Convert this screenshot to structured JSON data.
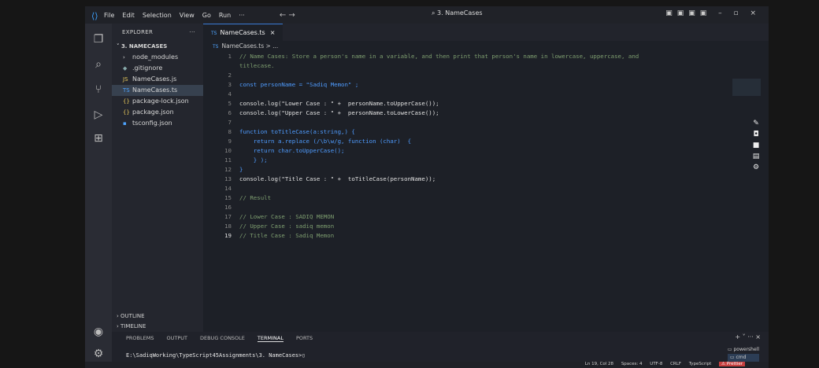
{
  "titlebar": {
    "menus": [
      "File",
      "Edit",
      "Selection",
      "View",
      "Go",
      "Run",
      "···"
    ],
    "nav": "← →",
    "search": "3. NameCases"
  },
  "sidebar": {
    "header": "EXPLORER",
    "more": "···",
    "root": "3. NAMECASES",
    "items": [
      {
        "icon": "›",
        "label": "node_modules"
      },
      {
        "icon": "◆",
        "label": ".gitignore"
      },
      {
        "icon": "JS",
        "label": "NameCases.js"
      },
      {
        "icon": "TS",
        "label": "NameCases.ts"
      },
      {
        "icon": "{}",
        "label": "package-lock.json"
      },
      {
        "icon": "{}",
        "label": "package.json"
      },
      {
        "icon": "▪",
        "label": "tsconfig.json"
      }
    ],
    "outline": "OUTLINE",
    "timeline": "TIMELINE"
  },
  "editor": {
    "tab_label": "NameCases.ts",
    "tab_ts": "TS",
    "breadcrumb": "NameCases.ts > ...",
    "lines": [
      {
        "n": "1",
        "t": "// Name Cases: Store a person's name in a variable, and then print that person's name in lowercase, uppercase, and"
      },
      {
        "n": "",
        "t": "titlecase."
      },
      {
        "n": "2",
        "t": ""
      },
      {
        "n": "3",
        "t": "const personName = \"Sadiq Memon\" ;"
      },
      {
        "n": "4",
        "t": ""
      },
      {
        "n": "5",
        "t": "console.log(\"Lower Case : \" +  personName.toUpperCase());"
      },
      {
        "n": "6",
        "t": "console.log(\"Upper Case : \" +  personName.toLowerCase());"
      },
      {
        "n": "7",
        "t": ""
      },
      {
        "n": "8",
        "t": "function toTitleCase(a:string,) {"
      },
      {
        "n": "9",
        "t": "    return a.replace (/\\b\\w/g, function (char)  {"
      },
      {
        "n": "10",
        "t": "    return char.toUpperCase();"
      },
      {
        "n": "11",
        "t": "    } );"
      },
      {
        "n": "12",
        "t": "}"
      },
      {
        "n": "13",
        "t": "console.log(\"Title Case : \" +  toTitleCase(personName));"
      },
      {
        "n": "14",
        "t": ""
      },
      {
        "n": "15",
        "t": "// Result"
      },
      {
        "n": "16",
        "t": ""
      },
      {
        "n": "17",
        "t": "// Lower Case : SADIQ MEMON"
      },
      {
        "n": "18",
        "t": "// Upper Case : sadiq memon"
      },
      {
        "n": "19",
        "t": "// Title Case : Sadiq Memon"
      }
    ]
  },
  "panel": {
    "tabs": [
      "PROBLEMS",
      "OUTPUT",
      "DEBUG CONSOLE",
      "TERMINAL",
      "PORTS"
    ],
    "active_tab": "TERMINAL",
    "terminal_line": "E:\\SadiqWorking\\TypeScript45Assignments\\3. NameCases>",
    "terminals": [
      "powershell",
      "cmd"
    ],
    "controls": "+ ˅ ··· ×"
  },
  "statusbar": {
    "position": "Ln 19, Col 28",
    "spaces": "Spaces: 4",
    "encoding": "UTF-8",
    "eol": "CRLF",
    "language": "TypeScript",
    "prettier": "⚠ Prettier"
  },
  "colors": {
    "accent": "#3da2ff",
    "background": "#1d2027"
  }
}
